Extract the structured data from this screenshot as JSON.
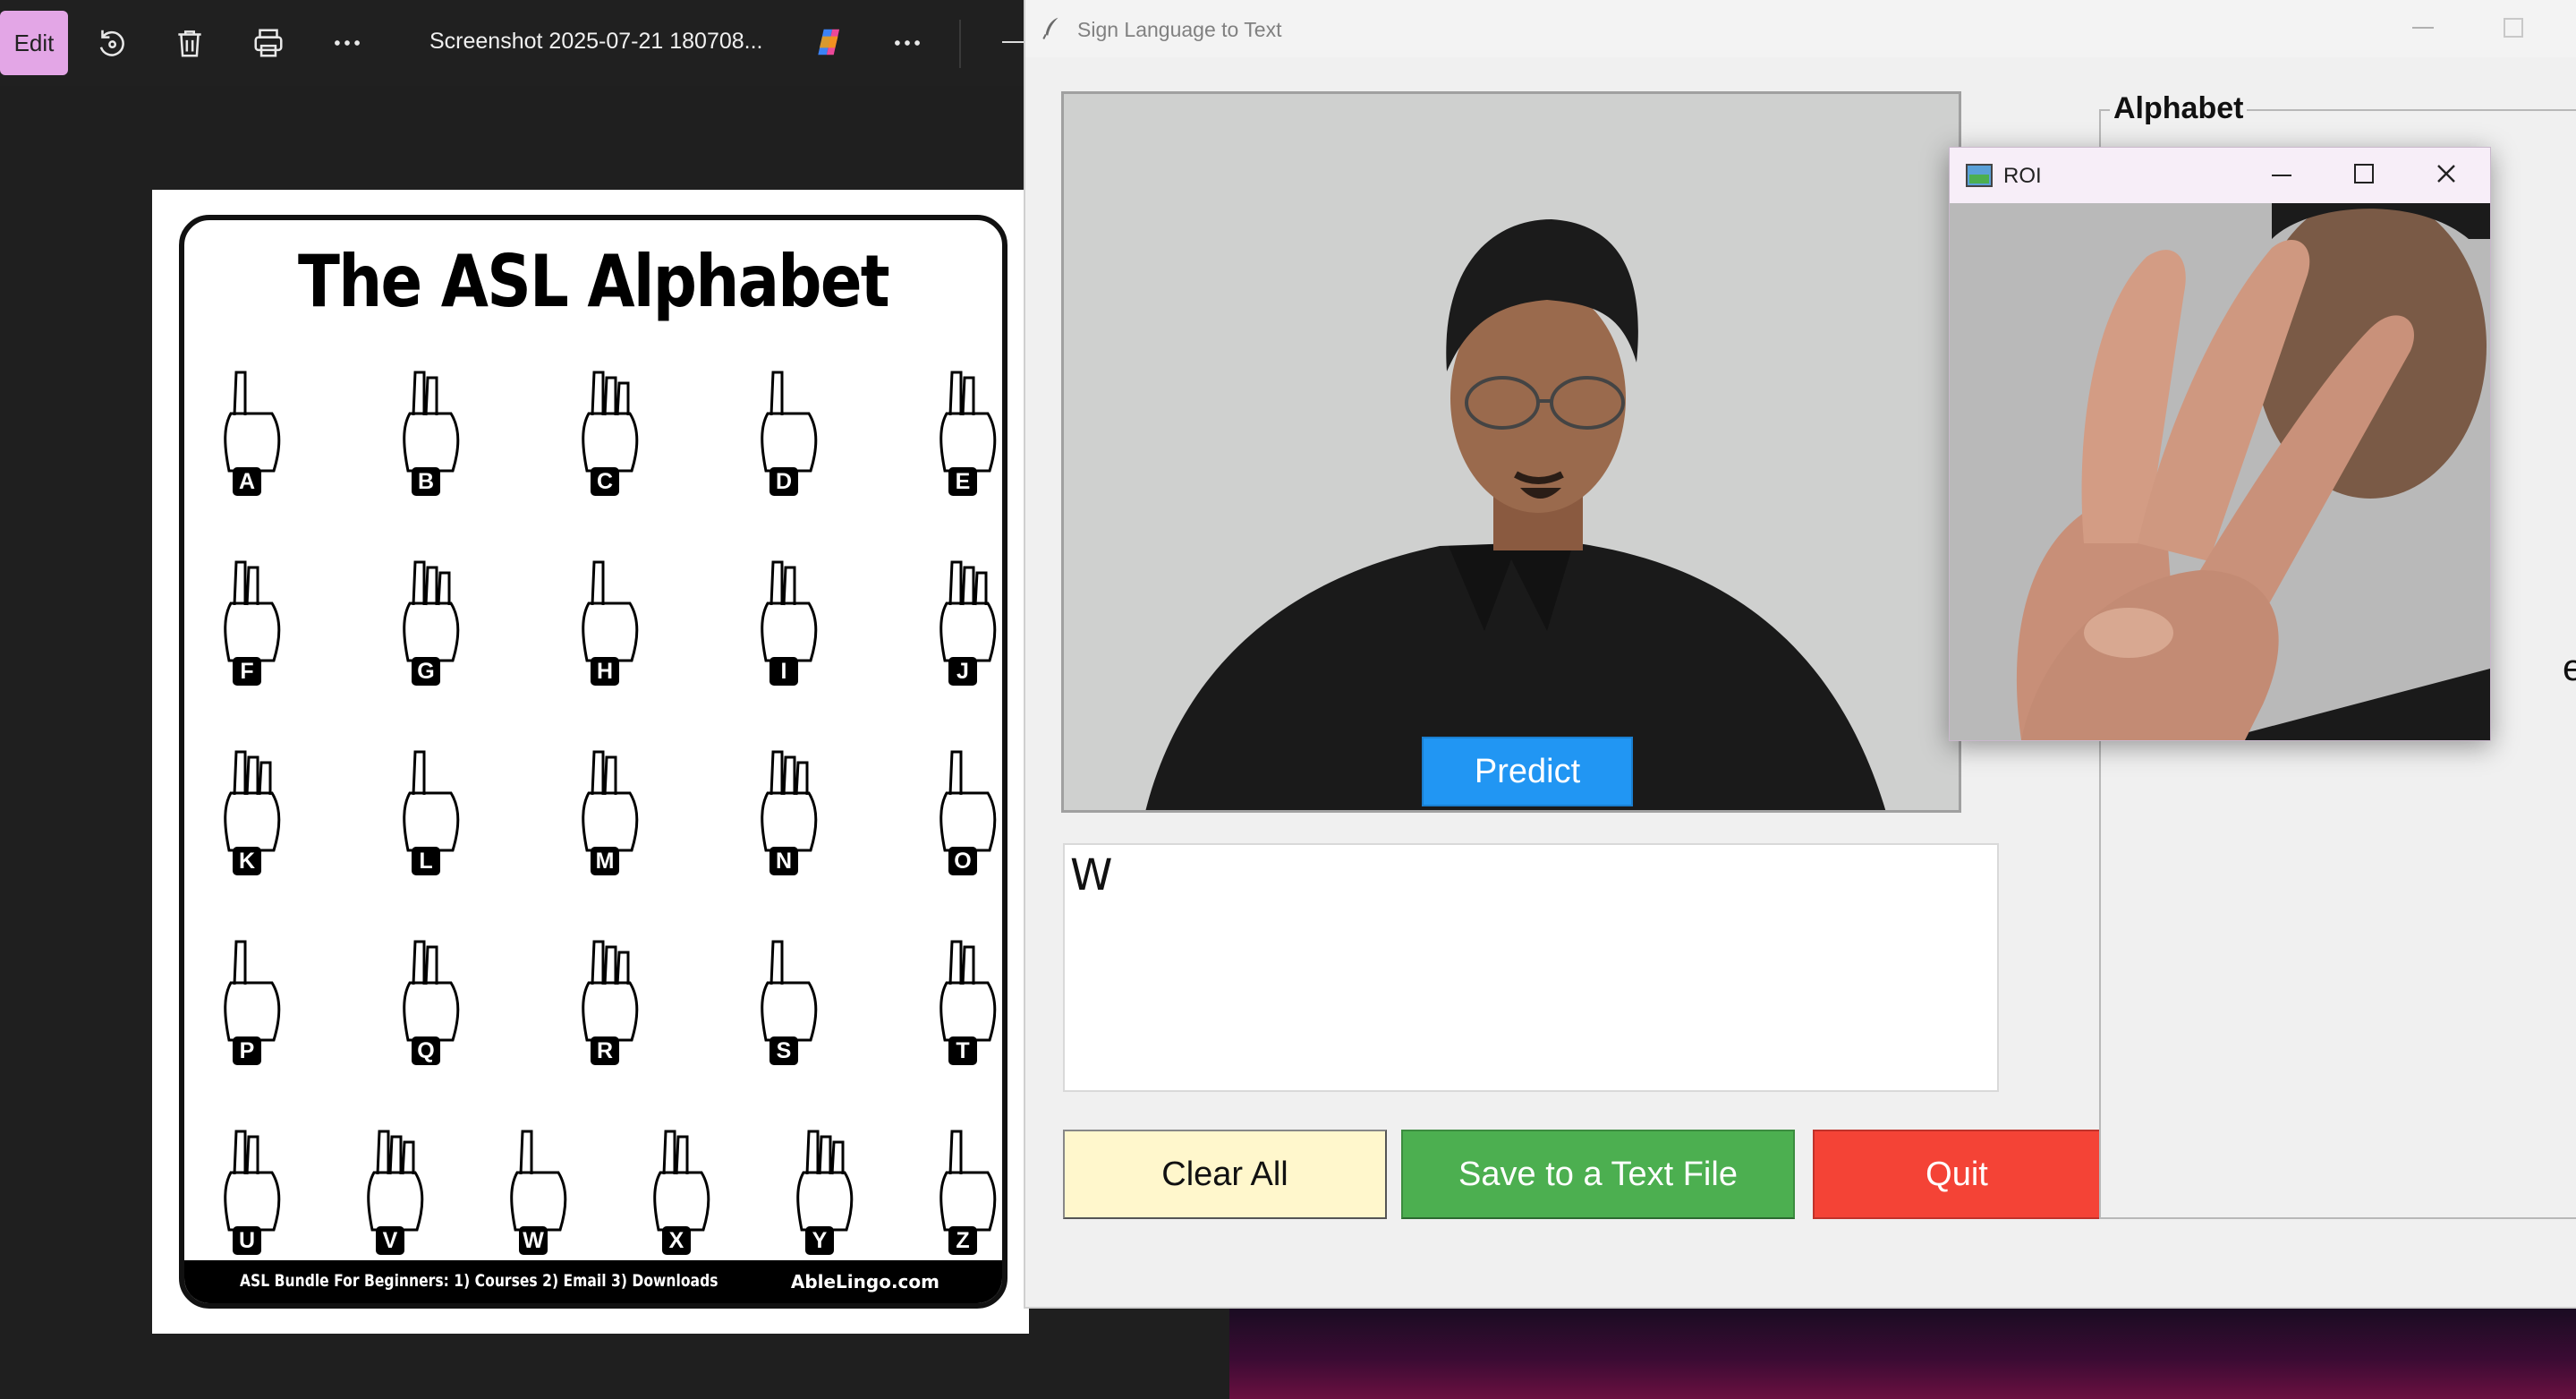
{
  "viewer": {
    "edit_label": "Edit",
    "title": "Screenshot 2025-07-21 180708...",
    "icons": [
      "rotate-icon",
      "trash-icon",
      "print-icon",
      "more-icon",
      "copilot-icon",
      "more-icon"
    ]
  },
  "asl_chart": {
    "title": "The ASL Alphabet",
    "footer_left": "ASL Bundle For Beginners:  1) Courses  2) Email  3) Downloads",
    "footer_right": "AbleLingo.com",
    "letters": [
      "A",
      "B",
      "C",
      "D",
      "E",
      "F",
      "G",
      "H",
      "I",
      "J",
      "K",
      "L",
      "M",
      "N",
      "O",
      "P",
      "Q",
      "R",
      "S",
      "T",
      "U",
      "V",
      "W",
      "X",
      "Y",
      "Z"
    ]
  },
  "app": {
    "title": "Sign Language to Text",
    "predict_label": "Predict",
    "output_text": "W",
    "clear_label": "Clear All",
    "save_label": "Save to a Text File",
    "quit_label": "Quit",
    "alphabet_label": "Alphabet",
    "alphabet_fragment": "e]"
  },
  "roi": {
    "title": "ROI"
  },
  "colors": {
    "predict": "#2196f3",
    "clear": "#fff7cc",
    "save": "#4caf50",
    "quit": "#f44336"
  }
}
